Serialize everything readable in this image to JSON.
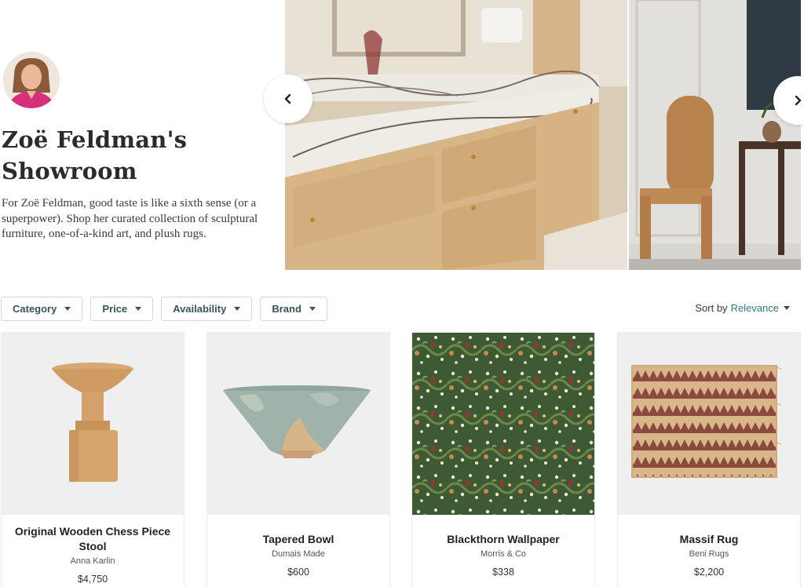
{
  "showroom": {
    "title": "Zoë Feldman's Showroom",
    "description": "For Zoë Feldman, good taste is like a sixth sense (or a superpower). Shop her curated collection of sculptural furniture, one-of-a-kind art, and plush rugs."
  },
  "carousel": {
    "prev_icon": "chevron-left-icon",
    "next_icon": "chevron-right-icon"
  },
  "filters": [
    {
      "label": "Category"
    },
    {
      "label": "Price"
    },
    {
      "label": "Availability"
    },
    {
      "label": "Brand"
    }
  ],
  "sort": {
    "prefix": "Sort by",
    "value": "Relevance"
  },
  "products": [
    {
      "name": "Original Wooden Chess Piece Stool",
      "brand": "Anna Karlin",
      "price": "$4,750"
    },
    {
      "name": "Tapered Bowl",
      "brand": "Dumais Made",
      "price": "$600"
    },
    {
      "name": "Blackthorn Wallpaper",
      "brand": "Morris & Co",
      "price": "$338"
    },
    {
      "name": "Massif Rug",
      "brand": "Beni Rugs",
      "price": "$2,200"
    }
  ],
  "colors": {
    "accent": "#2e7a80",
    "filter_border": "#c9dedd",
    "filter_text": "#35555a"
  }
}
